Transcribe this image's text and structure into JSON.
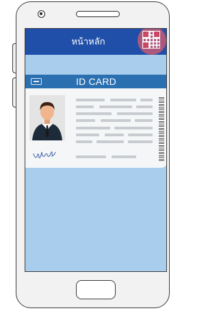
{
  "app": {
    "header_title": "หน้าหลัก",
    "header_color": "#1f4fa8",
    "screen_background": "#a9cdec",
    "qr_icon": "qr-code-icon",
    "qr_highlight_color": "#dc5a6e"
  },
  "id_card": {
    "title": "ID CARD",
    "header_color": "#2a6fb0",
    "chip_icon": "card-chip-icon",
    "photo": "person-photo-icon",
    "signature": "signature-icon",
    "barcode": "barcode-icon"
  },
  "device": {
    "home_button": "home-button",
    "camera": "camera-icon",
    "speaker": "speaker-grille"
  }
}
